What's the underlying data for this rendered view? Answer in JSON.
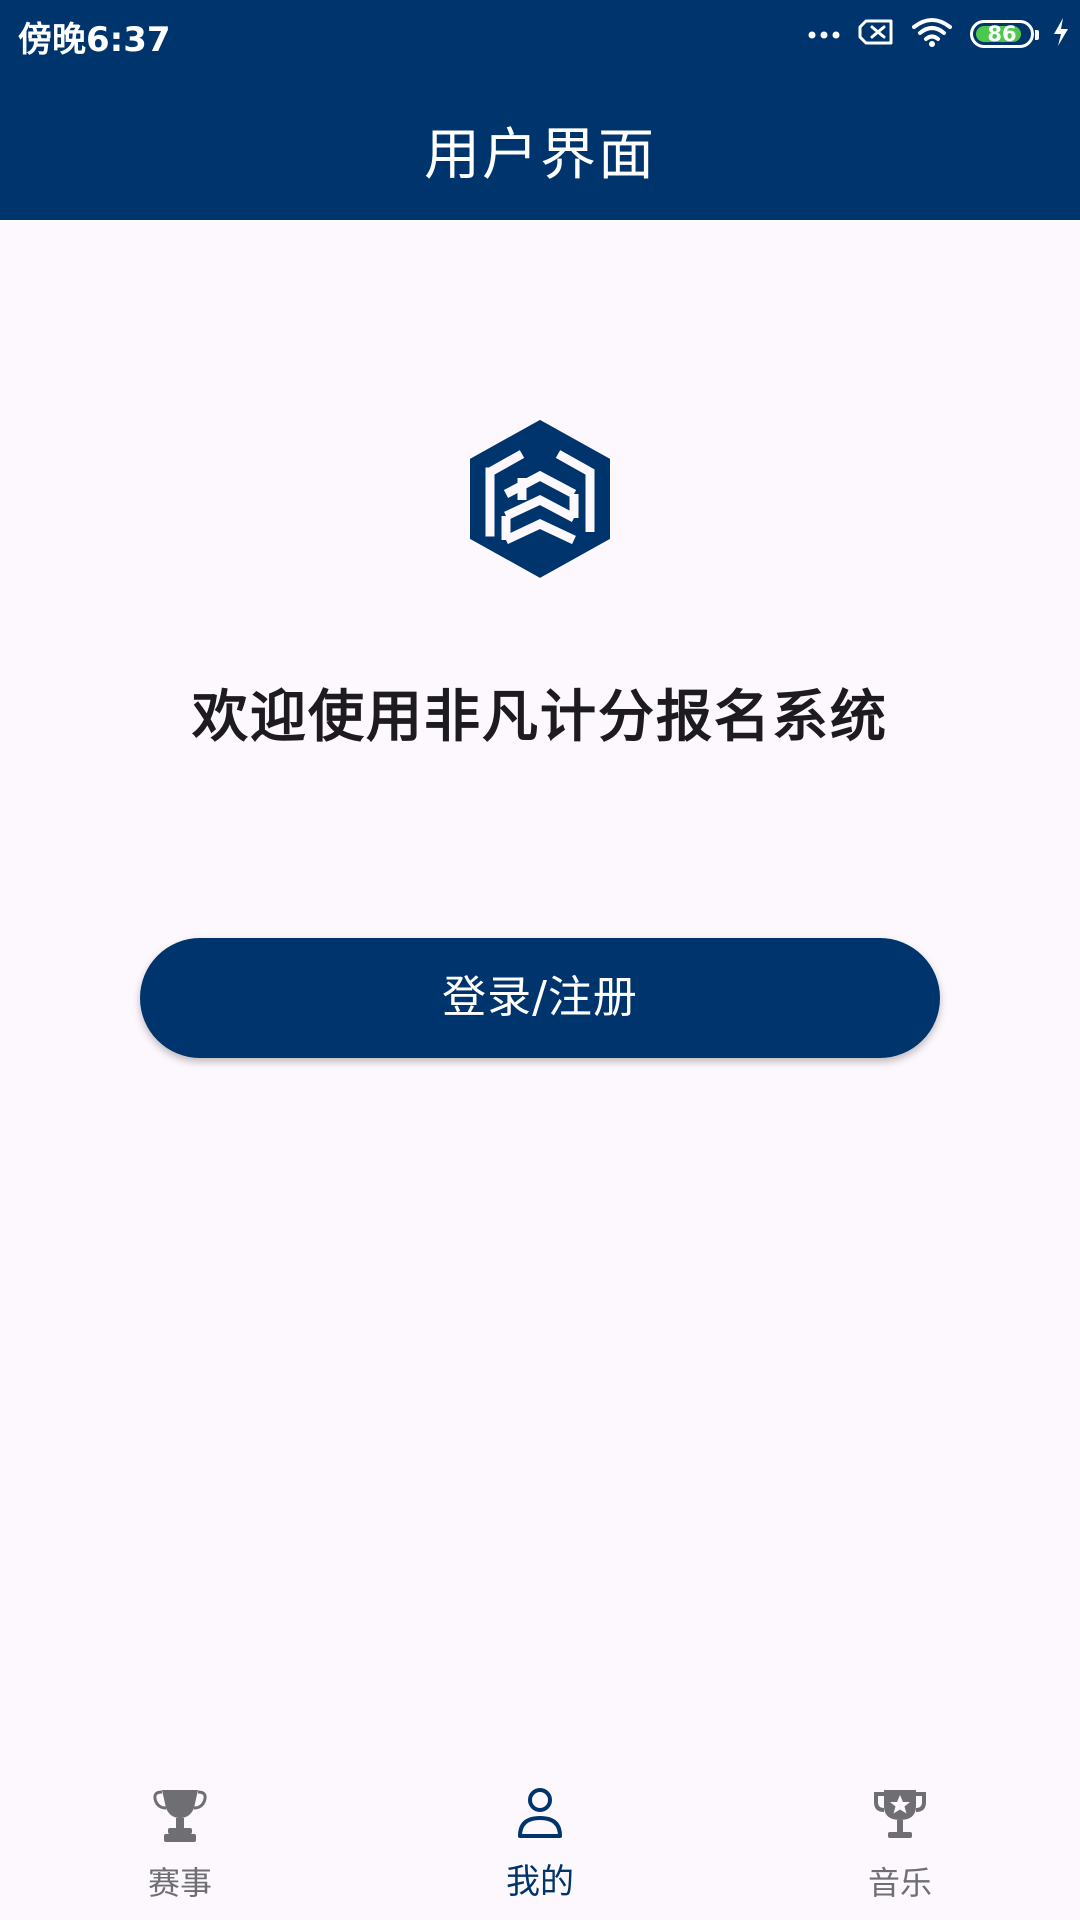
{
  "status_bar": {
    "time": "傍晚6:37",
    "battery": 0.86,
    "battery_label": "86",
    "icons": [
      "more-dots-icon",
      "sim-no-signal-icon",
      "wifi-icon",
      "battery-icon",
      "charging-bolt-icon"
    ]
  },
  "app_bar": {
    "title": "用户界面"
  },
  "main": {
    "logo": "app-logo",
    "welcome_text": "欢迎使用非凡计分报名系统",
    "login_button": "登录/注册"
  },
  "bottom_nav": {
    "items": [
      {
        "label": "赛事",
        "icon": "trophy-icon",
        "active": false
      },
      {
        "label": "我的",
        "icon": "person-icon",
        "active": true
      },
      {
        "label": "音乐",
        "icon": "star-trophy-icon",
        "active": false
      }
    ]
  },
  "colors": {
    "primary": "#00346c",
    "background": "#fdf8fd",
    "text_dark": "#1d1b20",
    "inactive": "#6e6e73",
    "battery_green": "#4cc94c"
  }
}
